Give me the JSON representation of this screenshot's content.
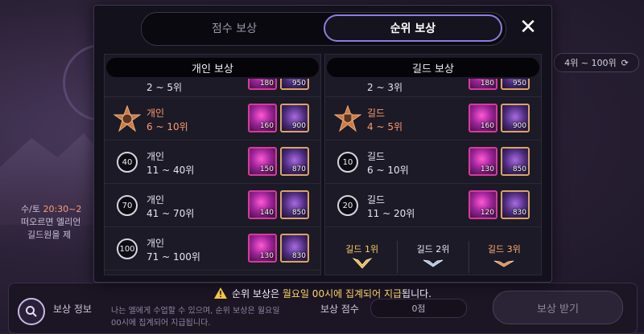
{
  "modal": {
    "tabs": [
      {
        "label": "점수 보상",
        "active": false
      },
      {
        "label": "순위 보상",
        "active": true
      }
    ],
    "close_label": "✕",
    "personal": {
      "title": "개인 보상",
      "partial_row": {
        "range": "2 ~ 5위",
        "gem_qty": "180",
        "ore_qty": "950"
      },
      "rows": [
        {
          "name": "개인",
          "range": "6 ~ 10위",
          "icon": "bronze-emblem-icon",
          "gem_qty": "160",
          "ore_qty": "900",
          "highlight": true
        },
        {
          "name": "개인",
          "range": "11 ~ 40위",
          "badge": "40",
          "gem_qty": "150",
          "ore_qty": "870"
        },
        {
          "name": "개인",
          "range": "41 ~ 70위",
          "badge": "70",
          "gem_qty": "140",
          "ore_qty": "850"
        },
        {
          "name": "개인",
          "range": "71 ~ 100위",
          "badge": "100",
          "gem_qty": "130",
          "ore_qty": "830"
        }
      ]
    },
    "guild": {
      "title": "길드 보상",
      "partial_row": {
        "range": "2 ~ 3위",
        "gem_qty": "180",
        "ore_qty": "950"
      },
      "rows": [
        {
          "name": "길드",
          "range": "4 ~ 5위",
          "icon": "bronze-shield-emblem-icon",
          "gem_qty": "160",
          "ore_qty": "900",
          "highlight": true
        },
        {
          "name": "길드",
          "range": "6 ~ 10위",
          "badge": "10",
          "gem_qty": "130",
          "ore_qty": "850"
        },
        {
          "name": "길드",
          "range": "11 ~ 20위",
          "badge": "20",
          "gem_qty": "120",
          "ore_qty": "830"
        }
      ],
      "ranks": [
        {
          "label": "길드 1위",
          "icon": "gold-wings-icon",
          "color": "#e8b64a"
        },
        {
          "label": "길드 2위",
          "icon": "silver-wings-icon",
          "color": "#a9c4dc"
        },
        {
          "label": "길드 3위",
          "icon": "bronze-wings-icon",
          "color": "#d88a4a"
        }
      ]
    },
    "notice": {
      "prefix": "순위 보상은",
      "emphasis": "월요일 00시에 집계되어 지급",
      "suffix": "됩니다.",
      "icon": "warning-icon"
    }
  },
  "background": {
    "range_button": "4위 ~ 100위",
    "range_icon": "refresh-icon",
    "info_line1_prefix": "수/토",
    "info_line1_time": "20:30~2",
    "info_line2": "떠오르면 엘리언",
    "info_line3": "길드원을 제",
    "bottom_left_label": "보상 정보",
    "bottom_mid_line1": "나는 엘에게 수업할 수 있으며, 순위 보상은 월요일",
    "bottom_mid_line2": "00시에 집계되어 지급됩니다.",
    "bottom_score_label": "보상 점수",
    "bottom_score_value": "0점",
    "claim_button": "보상 받기"
  },
  "colors": {
    "tab_active_border": "#8a80e0",
    "highlight_text": "#ff9a6c",
    "notice_emphasis": "#ffd36a",
    "gem_border": "#d43c9a",
    "ore_border": "#d9a46a"
  }
}
